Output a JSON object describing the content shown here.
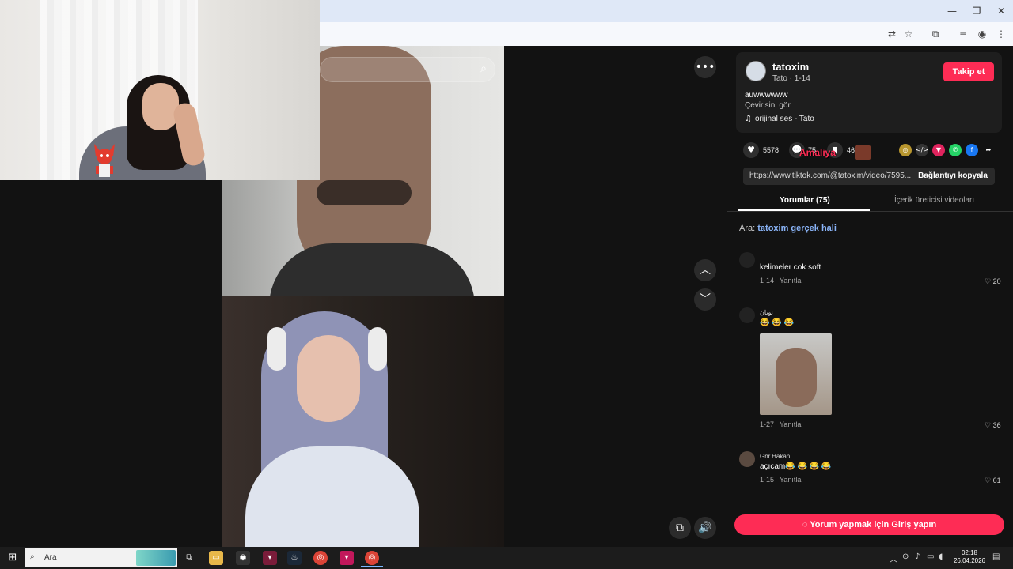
{
  "profile": {
    "username": "tatoxim",
    "subtitle": "Tato · 1-14",
    "follow_label": "Takip et",
    "description": "auwwwwww",
    "translate_label": "Çevirisini gör",
    "sound": "orijinal ses - Tato"
  },
  "actions": {
    "likes": "5578",
    "comments": "75",
    "saves": "46"
  },
  "overlay_text": "Amaliya",
  "share": {
    "url": "https://www.tiktok.com/@tatoxim/video/7595...",
    "copy_label": "Bağlantıyı kopyala"
  },
  "tabs": [
    {
      "label": "Yorumlar (75)"
    },
    {
      "label": "İçerik üreticisi videoları"
    }
  ],
  "search_suggest": {
    "prefix": "Ara:",
    "query": "tatoxim gerçek hali"
  },
  "comments": [
    {
      "name": "",
      "text": "kelimeler cok soft",
      "date": "1-14",
      "reply": "Yanıtla",
      "likes": "20"
    },
    {
      "name": "نوبان",
      "text": "😂 😂 😂",
      "date": "1-27",
      "reply": "Yanıtla",
      "likes": "36"
    },
    {
      "name": "Gnr.Hakan",
      "text": "açıcam😂 😂 😂 😂",
      "date": "1-15",
      "reply": "Yanıtla",
      "likes": "61"
    }
  ],
  "login_label": "Yorum yapmak için Giriş yapın",
  "taskbar": {
    "search_placeholder": "Ara",
    "time": "02:18",
    "date": "26.04.2026"
  },
  "colors": {
    "accent": "#fe2c55",
    "panel_bg": "#121212",
    "link": "#8ab4f8"
  }
}
